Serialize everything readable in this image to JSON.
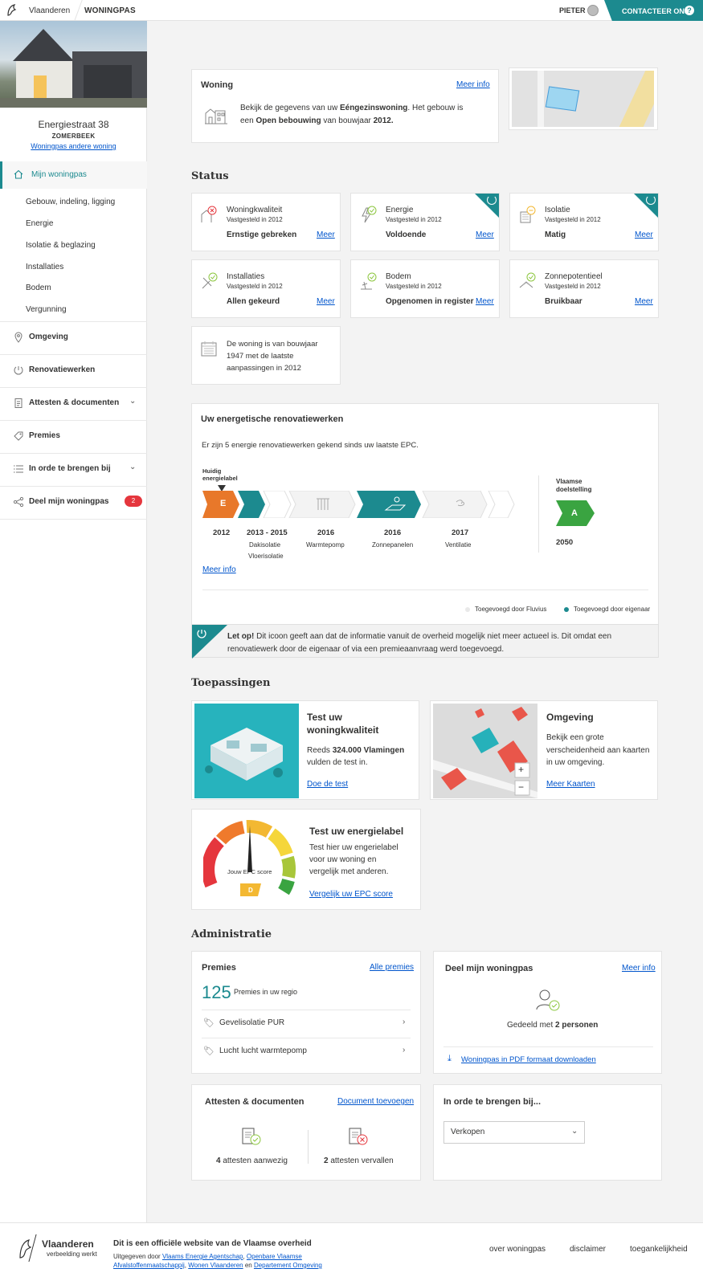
{
  "topbar": {
    "brand": "Vlaanderen",
    "app": "WONINGPAS",
    "user": "PIETER",
    "contact": "CONTACTEER ONS",
    "help": "?"
  },
  "sidebar": {
    "street": "Energiestraat 38",
    "city": "ZOMERBEEK",
    "other_home_link": "Woningpas andere woning",
    "active": "Mijn woningpas",
    "subitems": [
      "Gebouw, indeling, ligging",
      "Energie",
      "Isolatie & beglazing",
      "Installaties",
      "Bodem",
      "Vergunning"
    ],
    "items": [
      {
        "label": "Omgeving"
      },
      {
        "label": "Renovatiewerken"
      },
      {
        "label": "Attesten & documenten"
      },
      {
        "label": "Premies"
      },
      {
        "label": "In orde te brengen bij"
      },
      {
        "label": "Deel mijn woningpas",
        "badge": "2"
      }
    ]
  },
  "woning": {
    "title": "Woning",
    "more": "Meer info",
    "text_a": "Bekijk de gegevens van uw ",
    "text_b": "Eéngezinswoning",
    "text_c": ". Het gebouw is een ",
    "text_d": "Open bebouwing",
    "text_e": " van bouwjaar ",
    "text_f": "2012."
  },
  "status": {
    "title": "Status",
    "cards": [
      {
        "title": "Woningkwaliteit",
        "date": "Vastgesteld in 2012",
        "value": "Ernstige gebreken",
        "more": "Meer"
      },
      {
        "title": "Energie",
        "date": "Vastgesteld in 2012",
        "value": "Voldoende",
        "more": "Meer"
      },
      {
        "title": "Isolatie",
        "date": "Vastgesteld in 2012",
        "value": "Matig",
        "more": "Meer"
      },
      {
        "title": "Installaties",
        "date": "Vastgesteld in 2012",
        "value": "Allen gekeurd",
        "more": "Meer"
      },
      {
        "title": "Bodem",
        "date": "Vastgesteld in 2012",
        "value": "Opgenomen in register",
        "more": "Meer"
      },
      {
        "title": "Zonnepotentieel",
        "date": "Vastgesteld in 2012",
        "value": "Bruikbaar",
        "more": "Meer"
      }
    ],
    "year_line1": "De woning is van bouwjaar",
    "year_line2": "1947 met de laatste",
    "year_line3": "aanpassingen in 2012"
  },
  "renovation": {
    "title": "Uw energetische renovatiewerken",
    "intro": "Er zijn 5 energie renovatiewerken gekend sinds uw laatste EPC.",
    "current_label_1": "Huidig",
    "current_label_2": "energielabel",
    "current_value": "E",
    "steps": [
      {
        "year": "2012",
        "desc1": "",
        "desc2": ""
      },
      {
        "year": "2013 - 2015",
        "desc1": "Dakisolatie",
        "desc2": "Vloerisolatie"
      },
      {
        "year": "2016",
        "desc1": "Warmtepomp",
        "desc2": ""
      },
      {
        "year": "2016",
        "desc1": "Zonnepanelen",
        "desc2": ""
      },
      {
        "year": "2017",
        "desc1": "Ventilatie",
        "desc2": ""
      }
    ],
    "goal_label_1": "Vlaamse",
    "goal_label_2": "doelstelling",
    "goal_value": "A",
    "goal_year": "2050",
    "more": "Meer info",
    "legend_fluvius": "Toegevoegd door Fluvius",
    "legend_owner": "Toegevoegd door eigenaar",
    "warning_bold": "Let op!",
    "warning_text": " Dit icoon geeft aan dat de informatie vanuit de overheid mogelijk niet meer actueel is. Dit omdat een renovatiewerk door de eigenaar of via een premieaanvraag werd toegevoegd."
  },
  "applications": {
    "title": "Toepassingen",
    "quality": {
      "title1": "Test uw",
      "title2": "woningkwaliteit",
      "text_a": "Reeds ",
      "text_b": "324.000 Vlamingen",
      "text_c": "vulden de test in.",
      "link": "Doe de test"
    },
    "omgeving": {
      "title": "Omgeving",
      "text1": "Bekijk een grote",
      "text2": "verscheidenheid aan kaarten",
      "text3": "in uw omgeving.",
      "link": "Meer Kaarten",
      "zoom_in": "+",
      "zoom_out": "−"
    },
    "energy": {
      "title": "Test uw energielabel",
      "text1": "Test hier uw engerielabel",
      "text2": "voor uw woning en",
      "text3": "vergelijk met anderen.",
      "link": "Vergelijk uw EPC score",
      "gauge_label": "Jouw EPC score",
      "gauge_value": "D"
    }
  },
  "admin": {
    "title": "Administratie",
    "premies": {
      "title": "Premies",
      "link": "Alle premies",
      "count": "125",
      "count_label": "Premies in uw regio",
      "items": [
        "Gevelisolatie PUR",
        "Lucht lucht warmtepomp"
      ]
    },
    "share": {
      "title": "Deel mijn woningpas",
      "link": "Meer info",
      "shared_a": "Gedeeld met ",
      "shared_b": "2 personen",
      "download": "Woningpas in PDF formaat downloaden"
    },
    "docs": {
      "title": "Attesten & documenten",
      "link": "Document toevoegen",
      "present_n": "4",
      "present_label": " attesten aanwezig",
      "expired_n": "2",
      "expired_label": " attesten vervallen"
    },
    "order": {
      "title": "In orde te brengen bij...",
      "select_value": "Verkopen"
    }
  },
  "footer": {
    "logo_title": "Vlaanderen",
    "logo_sub": "verbeelding werkt",
    "official": "Dit is een officiële website van de Vlaamse overheid",
    "publisher_prefix": "Uitgegeven door ",
    "pub1": "Vlaams Energie Agentschap",
    "pub2": "Openbare Vlaamse Afvalstoffenmaatschappij",
    "pub3": "Wonen Vlaanderen",
    "pub_and": " en ",
    "pub4": "Departement Omgeving",
    "links": [
      "over woningpas",
      "disclaimer",
      "toegankelijkheid"
    ]
  },
  "colors": {
    "accent": "#1c8a8f",
    "link": "#0055cc",
    "label_e": "#e8782a",
    "label_a": "#3aa441",
    "badge": "#e5363d"
  }
}
